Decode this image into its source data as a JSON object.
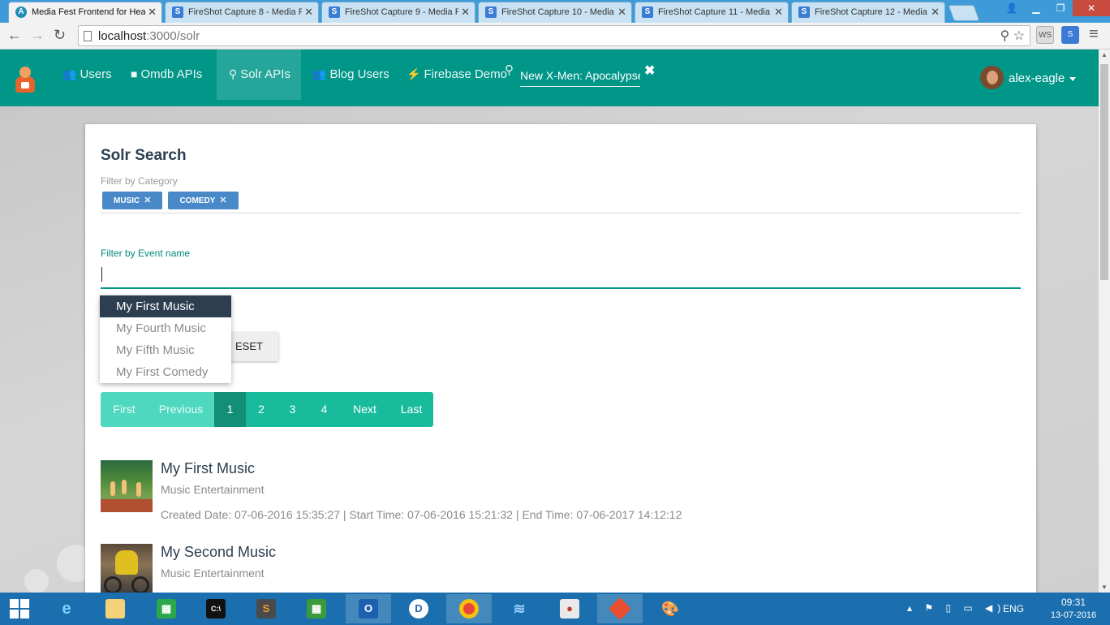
{
  "browser": {
    "tabs": [
      {
        "title": "Media Fest Frontend for Hea",
        "active": true
      },
      {
        "title": "FireShot Capture 8 - Media F"
      },
      {
        "title": "FireShot Capture 9 - Media F"
      },
      {
        "title": "FireShot Capture 10 - Media"
      },
      {
        "title": "FireShot Capture 11 - Media"
      },
      {
        "title": "FireShot Capture 12 - Media"
      }
    ],
    "url_host": "localhost",
    "url_rest": ":3000/solr"
  },
  "navbar": {
    "items": [
      {
        "label": "Users",
        "icon": "users-icon"
      },
      {
        "label": "Omdb APIs",
        "icon": "video-camera-icon"
      },
      {
        "label": "Solr APIs",
        "icon": "search-icon"
      },
      {
        "label": "Blog Users",
        "icon": "users-icon"
      },
      {
        "label": "Firebase Demo",
        "icon": "bolt-icon"
      }
    ],
    "search_value": "New X-Men: Apocalypse",
    "username": "alex-eagle"
  },
  "page": {
    "title": "Solr Search",
    "category_label": "Filter by Category",
    "categories": [
      "MUSIC",
      "COMEDY"
    ],
    "event_label": "Filter by Event name",
    "event_value": "",
    "suggestions": [
      "My First Music",
      "My Fourth Music",
      "My Fifth Music",
      "My First Comedy"
    ],
    "reset_label": "ESET",
    "pagination": [
      "First",
      "Previous",
      "1",
      "2",
      "3",
      "4",
      "Next",
      "Last"
    ],
    "current_page": "1",
    "results": [
      {
        "title": "My First Music",
        "category": "Music Entertainment",
        "meta": "Created Date: 07-06-2016 15:35:27 | Start Time: 07-06-2016 15:21:32 | End Time: 07-06-2017 14:12:12"
      },
      {
        "title": "My Second Music",
        "category": "Music Entertainment"
      }
    ]
  },
  "taskbar": {
    "language": "ENG",
    "time": "09:31",
    "date": "13-07-2016"
  },
  "colors": {
    "navbar": "#009688",
    "chip": "#4a89c8",
    "pager": "#18bc9c",
    "pager_active": "#128f76",
    "taskbar": "#1c6fae"
  }
}
